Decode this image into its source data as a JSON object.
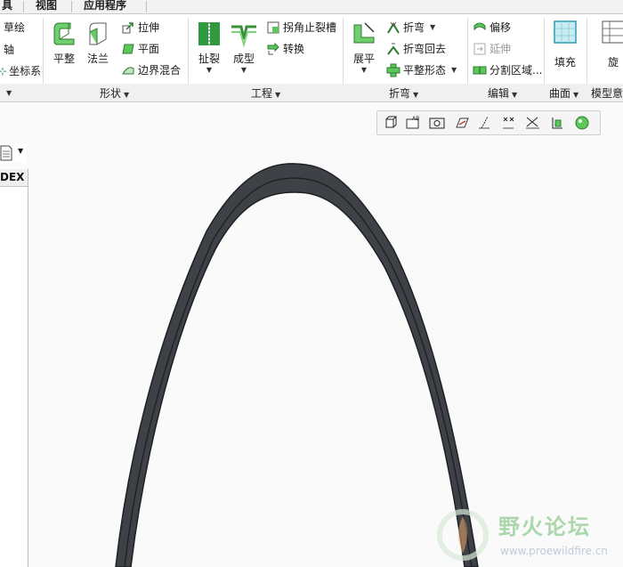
{
  "menu_tabs": [
    "具",
    "视图",
    "应用程序"
  ],
  "ribbon": {
    "col0": [
      "草绘",
      "轴",
      "坐标系"
    ],
    "shape_group": {
      "big_buttons": [
        "平整",
        "法兰"
      ],
      "small": [
        "拉伸",
        "平面",
        "边界混合"
      ],
      "label": "形状"
    },
    "engineering_group": {
      "big_buttons": [
        "扯裂",
        "成型"
      ],
      "small": [
        "拐角止裂槽",
        "转换"
      ],
      "label": "工程"
    },
    "bend_group": {
      "big_buttons": [
        "展平"
      ],
      "small": [
        "折弯",
        "折弯回去",
        "平整形态"
      ],
      "label": "折弯"
    },
    "edit_group": {
      "small": [
        "偏移",
        "延伸",
        "分割区域..."
      ],
      "label": "编辑"
    },
    "surface_group": {
      "big_buttons": [
        "填充"
      ],
      "label": "曲面"
    },
    "model_group": {
      "big_buttons": [
        "旋"
      ],
      "label": "模型意"
    }
  },
  "view_toolbar_icons": [
    "view-cube-icon",
    "annotation-icon",
    "screenshot-icon",
    "plane-display-icon",
    "axis-display-icon",
    "point-display-icon",
    "csys-display-icon",
    "spin-center-icon",
    "appearance-icon"
  ],
  "left_panel": {
    "header": "DEX"
  },
  "watermark": {
    "title": "野火论坛",
    "url": "www.proewildfire.cn"
  },
  "colors": {
    "part": "#3e4247",
    "part_edge": "#1d2024",
    "accent_green": "#3fa34d"
  }
}
